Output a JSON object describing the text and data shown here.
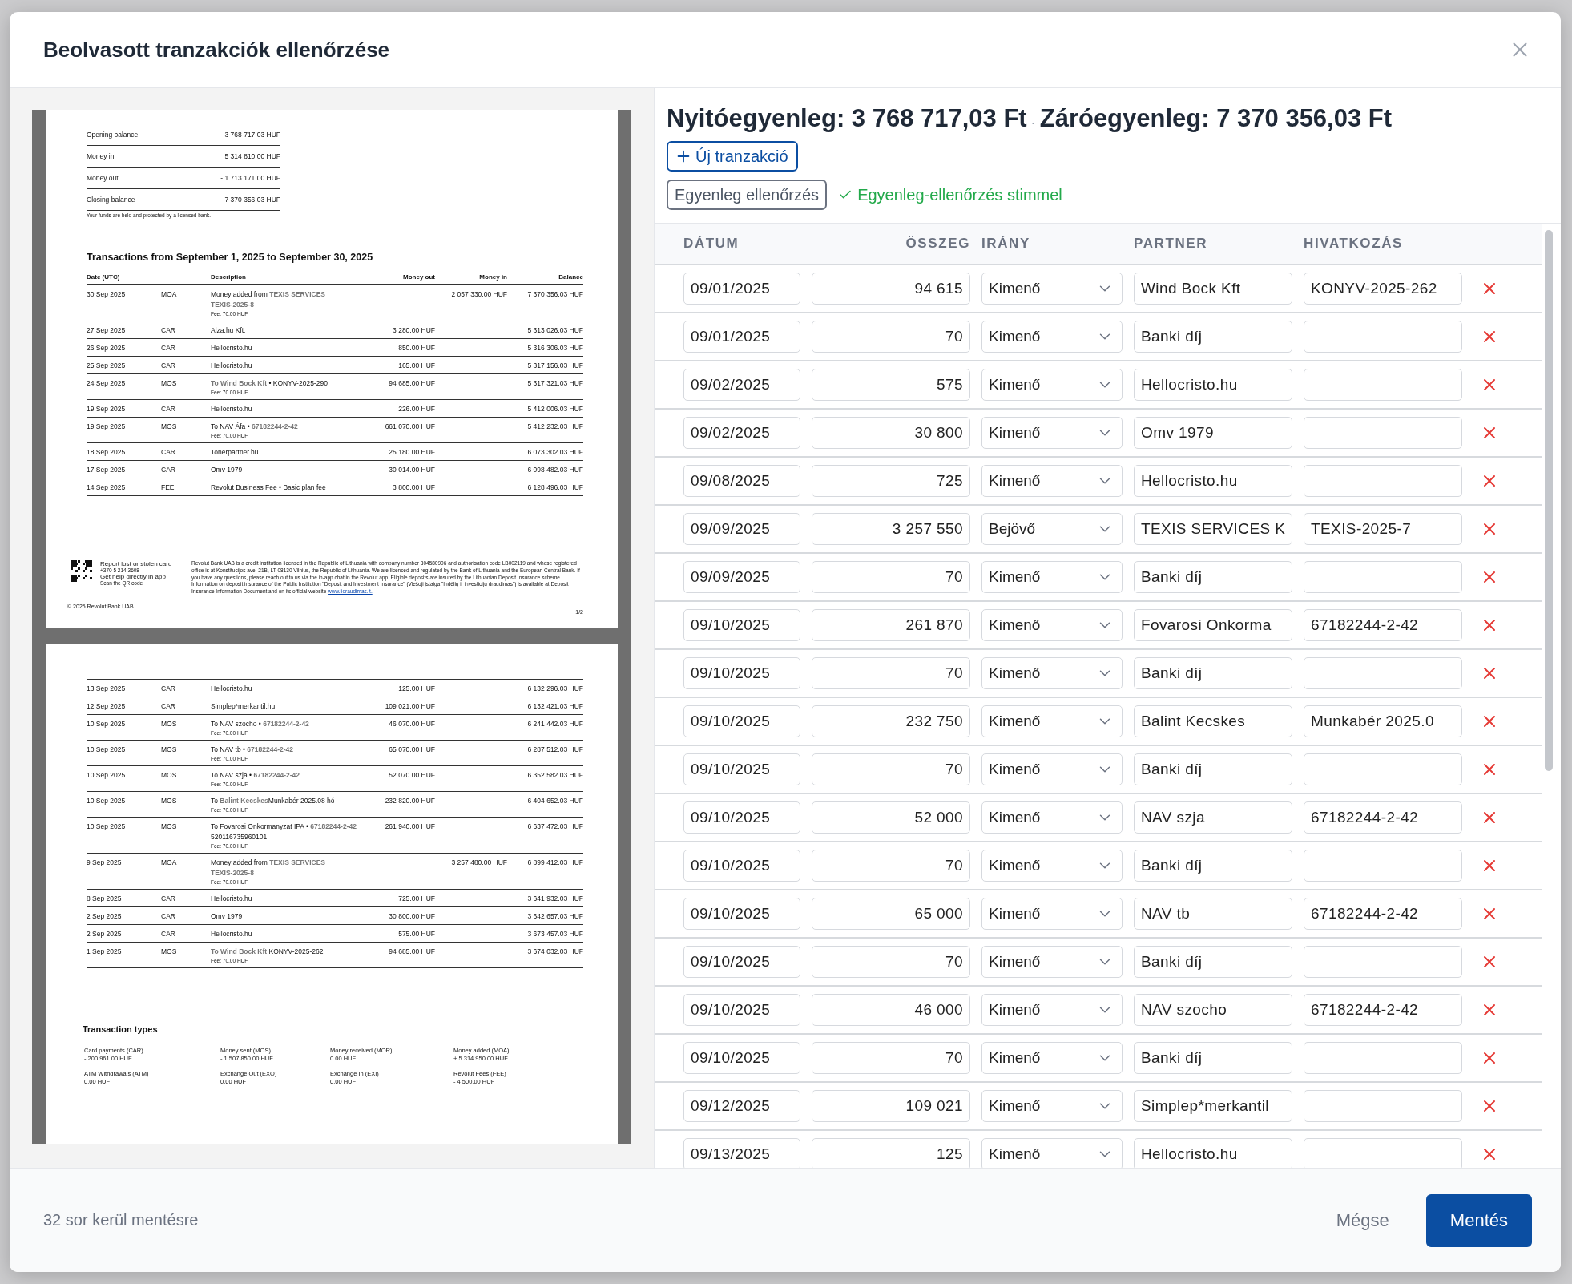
{
  "dialog": {
    "title": "Beolvasott tranzakciók ellenőrzése"
  },
  "document": {
    "pages": [
      {
        "summary": [
          {
            "label": "Opening balance",
            "value": "3 768 717.03 HUF"
          },
          {
            "label": "Money in",
            "value": "5 314 810.00 HUF"
          },
          {
            "label": "Money out",
            "value": "- 1 713 171.00 HUF"
          },
          {
            "label": "Closing balance",
            "value": "7 370 356.03 HUF"
          }
        ],
        "note": "Your funds are held and protected by a licensed bank.",
        "section_title": "Transactions from September 1, 2025 to September 30, 2025",
        "columns": [
          "Date (UTC)",
          "Description",
          "Money out",
          "Money in",
          "Balance"
        ],
        "rows": [
          {
            "date": "30 Sep 2025",
            "type": "MOA",
            "desc": "Money added from **TEXIS SERVICES**",
            "lines": [
              "**TEXIS-2025-8**"
            ],
            "fee": "Fee: 70.00 HUF",
            "in": "2 057 330.00 HUF",
            "balance": "7 370 356.03 HUF"
          },
          {
            "date": "27 Sep 2025",
            "type": "CAR",
            "desc": "Alza.hu Kft.",
            "out": "3 280.00 HUF",
            "balance": "5 313 026.03 HUF"
          },
          {
            "date": "26 Sep 2025",
            "type": "CAR",
            "desc": "Hellocristo.hu",
            "out": "850.00 HUF",
            "balance": "5 316 306.03 HUF"
          },
          {
            "date": "25 Sep 2025",
            "type": "CAR",
            "desc": "Hellocristo.hu",
            "out": "165.00 HUF",
            "balance": "5 317 156.03 HUF"
          },
          {
            "date": "24 Sep 2025",
            "type": "MOS",
            "desc": "**To Wind Bock Kft** • KONYV-2025-290",
            "fee": "Fee: 70.00 HUF",
            "out": "94 685.00 HUF",
            "balance": "5 317 321.03 HUF"
          },
          {
            "date": "19 Sep 2025",
            "type": "CAR",
            "desc": "Hellocristo.hu",
            "out": "226.00 HUF",
            "balance": "5 412 006.03 HUF"
          },
          {
            "date": "19 Sep 2025",
            "type": "MOS",
            "desc": "To NAV Áfa • **67182244-2-42**",
            "fee": "Fee: 70.00 HUF",
            "out": "661 070.00 HUF",
            "balance": "5 412 232.03 HUF"
          },
          {
            "date": "18 Sep 2025",
            "type": "CAR",
            "desc": "Tonerpartner.hu",
            "out": "25 180.00 HUF",
            "balance": "6 073 302.03 HUF"
          },
          {
            "date": "17 Sep 2025",
            "type": "CAR",
            "desc": "Omv 1979",
            "out": "30 014.00 HUF",
            "balance": "6 098 482.03 HUF"
          },
          {
            "date": "14 Sep 2025",
            "type": "FEE",
            "desc": "Revolut Business Fee • Basic plan fee",
            "out": "3 800.00 HUF",
            "balance": "6 128 496.03 HUF"
          }
        ],
        "footer": {
          "report_lines": [
            "Report lost or stolen card",
            "+370 5 214 3608",
            "Get help directly in app",
            "Scan the QR code"
          ],
          "legal": "Revolut Bank UAB is a credit institution licensed in the Republic of Lithuania with company number 304580906 and authorisation code LB002119 and whose registered office is at Konstitucijos ave. 21B, LT-08130 Vilnius, the Republic of Lithuania. We are licensed and regulated by the Bank of Lithuania and the European Central Bank. If you have any questions, please reach out to us via the in-app chat in the Revolut app. Eligible deposits are insured by the Lithuanian Deposit Insurance scheme. Information on deposit insurance of the Public Institution \"Deposit and Investment Insurance\" (Viešoji įstaiga \"Indėlių ir investicijų draudimas\") is available at Deposit Insurance Information Document and on its official website",
          "link": "www.iidraudimas.lt.",
          "copyright": "© 2025 Revolut Bank UAB",
          "page_number": "1/2"
        }
      },
      {
        "rows": [
          {
            "date": "13 Sep 2025",
            "type": "CAR",
            "desc": "Hellocristo.hu",
            "out": "125.00 HUF",
            "balance": "6 132 296.03 HUF"
          },
          {
            "date": "12 Sep 2025",
            "type": "CAR",
            "desc": "Simplep*merkantil.hu",
            "out": "109 021.00 HUF",
            "balance": "6 132 421.03 HUF"
          },
          {
            "date": "10 Sep 2025",
            "type": "MOS",
            "desc": "To NAV szocho • **67182244-2-42**",
            "fee": "Fee: 70.00 HUF",
            "out": "46 070.00 HUF",
            "balance": "6 241 442.03 HUF"
          },
          {
            "date": "10 Sep 2025",
            "type": "MOS",
            "desc": "To NAV tb • **67182244-2-42**",
            "fee": "Fee: 70.00 HUF",
            "out": "65 070.00 HUF",
            "balance": "6 287 512.03 HUF"
          },
          {
            "date": "10 Sep 2025",
            "type": "MOS",
            "desc": "To NAV szja • **67182244-2-42**",
            "fee": "Fee: 70.00 HUF",
            "out": "52 070.00 HUF",
            "balance": "6 352 582.03 HUF"
          },
          {
            "date": "10 Sep 2025",
            "type": "MOS",
            "desc": "To **Balint Kecskes**Munkabér 2025.08 hó",
            "fee": "Fee: 70.00 HUF",
            "out": "232 820.00 HUF",
            "balance": "6 404 652.03 HUF"
          },
          {
            "date": "10 Sep 2025",
            "type": "MOS",
            "desc": "To Fovarosi Onkormanyzat IPA • **67182244-2-42**",
            "lines": [
              "520116735960101"
            ],
            "fee": "Fee: 70.00 HUF",
            "out": "261 940.00 HUF",
            "balance": "6 637 472.03 HUF"
          },
          {
            "date": "9 Sep 2025",
            "type": "MOA",
            "desc": "Money added from **TEXIS SERVICES**",
            "lines": [
              "**TEXIS-2025-8**"
            ],
            "fee": "Fee: 70.00 HUF",
            "in": "3 257 480.00 HUF",
            "balance": "6 899 412.03 HUF"
          },
          {
            "date": "8 Sep 2025",
            "type": "CAR",
            "desc": "Hellocristo.hu",
            "out": "725.00 HUF",
            "balance": "3 641 932.03 HUF"
          },
          {
            "date": "2 Sep 2025",
            "type": "CAR",
            "desc": "Omv 1979",
            "out": "30 800.00 HUF",
            "balance": "3 642 657.03 HUF"
          },
          {
            "date": "2 Sep 2025",
            "type": "CAR",
            "desc": "Hellocristo.hu",
            "out": "575.00 HUF",
            "balance": "3 673 457.03 HUF"
          },
          {
            "date": "1 Sep 2025",
            "type": "MOS",
            "desc": "**To Wind Bock Kft**   KONYV-2025-262",
            "fee": "Fee: 70.00 HUF",
            "out": "94 685.00 HUF",
            "balance": "3 674 032.03 HUF"
          }
        ],
        "types_title": "Transaction types",
        "types": [
          {
            "label": "Card payments (CAR)",
            "value": "- 200 961.00 HUF"
          },
          {
            "label": "Money sent (MOS)",
            "value": "- 1 507 850.00 HUF"
          },
          {
            "label": "Money received (MOR)",
            "value": "0.00 HUF"
          },
          {
            "label": "Money added (MOA)",
            "value": "+ 5 314 950.00 HUF"
          },
          {
            "label": "ATM Withdrawals (ATM)",
            "value": "0.00 HUF"
          },
          {
            "label": "Exchange Out (EXO)",
            "value": "0.00 HUF"
          },
          {
            "label": "Exchange In (EXI)",
            "value": "0.00 HUF"
          },
          {
            "label": "Revolut Fees (FEE)",
            "value": "- 4 500.00 HUF"
          }
        ]
      }
    ]
  },
  "summary": {
    "opening": "Nyitóegyenleg: 3 768 717,03 Ft",
    "separator": "·",
    "closing": "Záróegyenleg: 7 370 356,03 Ft"
  },
  "new_button": "Új tranzakció",
  "check_button": "Egyenleg ellenőrzés",
  "check_result": "Egyenleg-ellenőrzés stimmel",
  "table": {
    "columns": [
      "DÁTUM",
      "ÖSSZEG",
      "IRÁNY",
      "PARTNER",
      "HIVATKOZÁS"
    ],
    "rows": [
      {
        "date": "09/01/2025",
        "amount": "94 615",
        "direction": "Kimenő",
        "partner": "Wind Bock Kft",
        "reference": "KONYV-2025-262"
      },
      {
        "date": "09/01/2025",
        "amount": "70",
        "direction": "Kimenő",
        "partner": "Banki díj"
      },
      {
        "date": "09/02/2025",
        "amount": "575",
        "direction": "Kimenő",
        "partner": "Hellocristo.hu"
      },
      {
        "date": "09/02/2025",
        "amount": "30 800",
        "direction": "Kimenő",
        "partner": "Omv 1979"
      },
      {
        "date": "09/08/2025",
        "amount": "725",
        "direction": "Kimenő",
        "partner": "Hellocristo.hu"
      },
      {
        "date": "09/09/2025",
        "amount": "3 257 550",
        "direction": "Bejövő",
        "partner": "TEXIS SERVICES K",
        "reference": "TEXIS-2025-7"
      },
      {
        "date": "09/09/2025",
        "amount": "70",
        "direction": "Kimenő",
        "partner": "Banki díj"
      },
      {
        "date": "09/10/2025",
        "amount": "261 870",
        "direction": "Kimenő",
        "partner": "Fovarosi Onkorma",
        "reference": "67182244-2-42"
      },
      {
        "date": "09/10/2025",
        "amount": "70",
        "direction": "Kimenő",
        "partner": "Banki díj"
      },
      {
        "date": "09/10/2025",
        "amount": "232 750",
        "direction": "Kimenő",
        "partner": "Balint Kecskes",
        "reference": "Munkabér 2025.0"
      },
      {
        "date": "09/10/2025",
        "amount": "70",
        "direction": "Kimenő",
        "partner": "Banki díj"
      },
      {
        "date": "09/10/2025",
        "amount": "52 000",
        "direction": "Kimenő",
        "partner": "NAV szja",
        "reference": "67182244-2-42"
      },
      {
        "date": "09/10/2025",
        "amount": "70",
        "direction": "Kimenő",
        "partner": "Banki díj"
      },
      {
        "date": "09/10/2025",
        "amount": "65 000",
        "direction": "Kimenő",
        "partner": "NAV tb",
        "reference": "67182244-2-42"
      },
      {
        "date": "09/10/2025",
        "amount": "70",
        "direction": "Kimenő",
        "partner": "Banki díj"
      },
      {
        "date": "09/10/2025",
        "amount": "46 000",
        "direction": "Kimenő",
        "partner": "NAV szocho",
        "reference": "67182244-2-42"
      },
      {
        "date": "09/10/2025",
        "amount": "70",
        "direction": "Kimenő",
        "partner": "Banki díj"
      },
      {
        "date": "09/12/2025",
        "amount": "109 021",
        "direction": "Kimenő",
        "partner": "Simplep*merkantil"
      },
      {
        "date": "09/13/2025",
        "amount": "125",
        "direction": "Kimenő",
        "partner": "Hellocristo.hu"
      }
    ]
  },
  "footer": {
    "status": "32 sor kerül mentésre",
    "cancel": "Mégse",
    "save": "Mentés"
  }
}
